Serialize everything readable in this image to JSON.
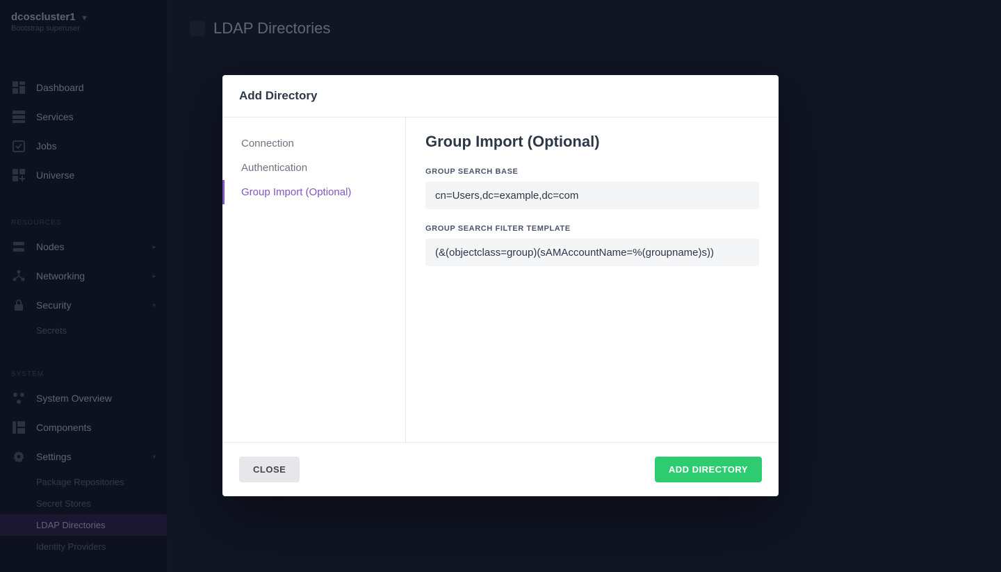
{
  "cluster": {
    "name": "dcoscluster1",
    "subtitle": "Bootstrap superuser"
  },
  "sidebar": {
    "main": [
      {
        "label": "Dashboard",
        "icon": "dashboard"
      },
      {
        "label": "Services",
        "icon": "services"
      },
      {
        "label": "Jobs",
        "icon": "jobs"
      },
      {
        "label": "Universe",
        "icon": "universe"
      }
    ],
    "sections": [
      {
        "title": "RESOURCES",
        "items": [
          {
            "label": "Nodes",
            "icon": "nodes",
            "chev": "right"
          },
          {
            "label": "Networking",
            "icon": "networking",
            "chev": "right"
          },
          {
            "label": "Security",
            "icon": "security",
            "chev": "down",
            "children": [
              {
                "label": "Secrets"
              }
            ]
          }
        ]
      },
      {
        "title": "SYSTEM",
        "items": [
          {
            "label": "System Overview",
            "icon": "overview"
          },
          {
            "label": "Components",
            "icon": "components"
          },
          {
            "label": "Settings",
            "icon": "settings",
            "chev": "down",
            "children": [
              {
                "label": "Package Repositories"
              },
              {
                "label": "Secret Stores"
              },
              {
                "label": "LDAP Directories",
                "active": true
              },
              {
                "label": "Identity Providers"
              }
            ]
          }
        ]
      }
    ]
  },
  "page": {
    "title": "LDAP Directories"
  },
  "modal": {
    "title": "Add Directory",
    "side": [
      {
        "label": "Connection"
      },
      {
        "label": "Authentication"
      },
      {
        "label": "Group Import (Optional)",
        "active": true
      }
    ],
    "content": {
      "heading": "Group Import (Optional)",
      "fields": {
        "search_base": {
          "label": "GROUP SEARCH BASE",
          "value": "cn=Users,dc=example,dc=com"
        },
        "filter_template": {
          "label": "GROUP SEARCH FILTER TEMPLATE",
          "value": "(&(objectclass=group)(sAMAccountName=%(groupname)s))"
        }
      }
    },
    "buttons": {
      "close": "CLOSE",
      "primary": "ADD DIRECTORY"
    }
  }
}
